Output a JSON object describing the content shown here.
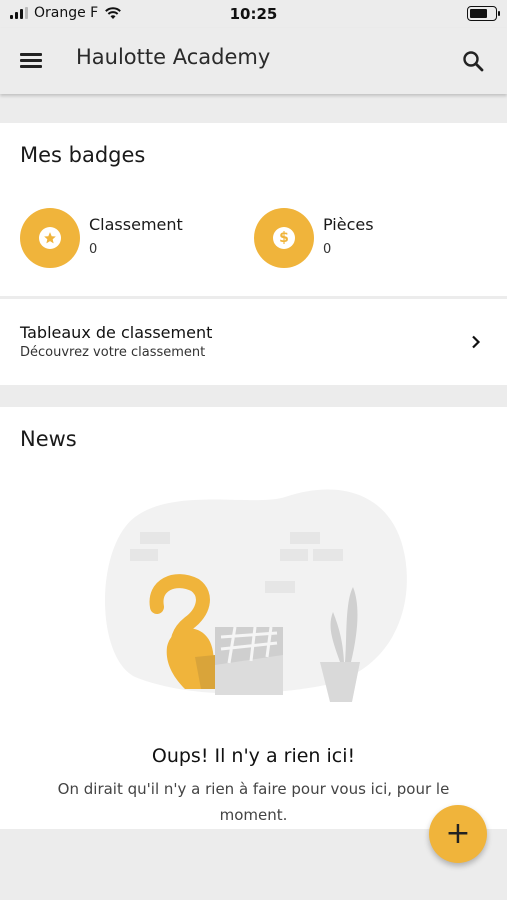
{
  "status_bar": {
    "carrier": "Orange F",
    "time": "10:25"
  },
  "app_bar": {
    "title": "Haulotte Academy"
  },
  "badges": {
    "title": "Mes badges",
    "items": [
      {
        "label": "Classement",
        "count": "0",
        "icon": "star-icon"
      },
      {
        "label": "Pièces",
        "count": "0",
        "icon": "dollar-coin-icon"
      }
    ]
  },
  "leaderboard": {
    "title": "Tableaux de classement",
    "subtitle": "Découvrez votre classement"
  },
  "news": {
    "title": "News",
    "empty_title": "Oups! Il n'y a rien ici!",
    "empty_text": "On dirait qu'il n'y a rien à faire pour vous ici, pour le moment."
  },
  "fab": {
    "label": "+"
  },
  "colors": {
    "accent": "#f0b43b",
    "background": "#ececec",
    "card": "#ffffff"
  }
}
